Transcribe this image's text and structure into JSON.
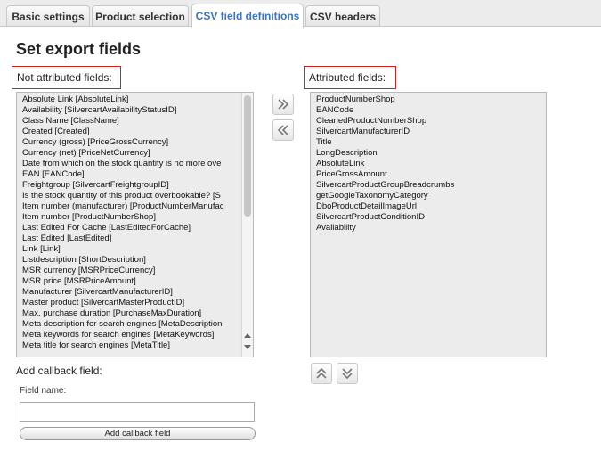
{
  "tabs": [
    {
      "label": "Basic settings"
    },
    {
      "label": "Product selection"
    },
    {
      "label": "CSV field definitions"
    },
    {
      "label": "CSV headers"
    }
  ],
  "active_tab": "CSV field definitions",
  "section_title": "Set export fields",
  "not_attributed": {
    "label": "Not attributed fields:",
    "items": [
      "Absolute Link [AbsoluteLink]",
      "Availability [SilvercartAvailabilityStatusID]",
      "Class Name [ClassName]",
      "Created [Created]",
      "Currency (gross) [PriceGrossCurrency]",
      "Currency (net) [PriceNetCurrency]",
      "Date from which on the stock quantity is no more ove",
      "EAN [EANCode]",
      "Freightgroup [SilvercartFreightgroupID]",
      "Is the stock quantity of this product overbookable? [S",
      "Item number (manufacturer) [ProductNumberManufac",
      "Item number [ProductNumberShop]",
      "Last Edited For Cache [LastEditedForCache]",
      "Last Edited [LastEdited]",
      "Link [Link]",
      "Listdescription [ShortDescription]",
      "MSR currency [MSRPriceCurrency]",
      "MSR price [MSRPriceAmount]",
      "Manufacturer [SilvercartManufacturerID]",
      "Master product [SilvercartMasterProductID]",
      "Max. purchase duration [PurchaseMaxDuration]",
      "Meta description for search engines [MetaDescription",
      "Meta keywords for search engines [MetaKeywords]",
      "Meta title for search engines [MetaTitle]"
    ]
  },
  "attributed": {
    "label": "Attributed fields:",
    "items": [
      "ProductNumberShop",
      "EANCode",
      "CleanedProductNumberShop",
      "SilvercartManufacturerID",
      "Title",
      "LongDescription",
      "AbsoluteLink",
      "PriceGrossAmount",
      "SilvercartProductGroupBreadcrumbs",
      "getGoogleTaxonomyCategory",
      "DboProductDetailImageUrl",
      "SilvercartProductConditionID",
      "Availability"
    ]
  },
  "icons": {
    "move_right": "double-chevron-right-icon",
    "move_left": "double-chevron-left-icon",
    "move_up": "double-chevron-up-icon",
    "move_down": "double-chevron-down-icon"
  },
  "callback": {
    "title": "Add callback field:",
    "field_label": "Field name:",
    "field_value": "",
    "field_placeholder": "",
    "button_label": "Add callback field"
  },
  "colors": {
    "active_tab_text": "#3b74c2",
    "label_border": "#cc2222",
    "listbox_bg": "#ececec"
  }
}
